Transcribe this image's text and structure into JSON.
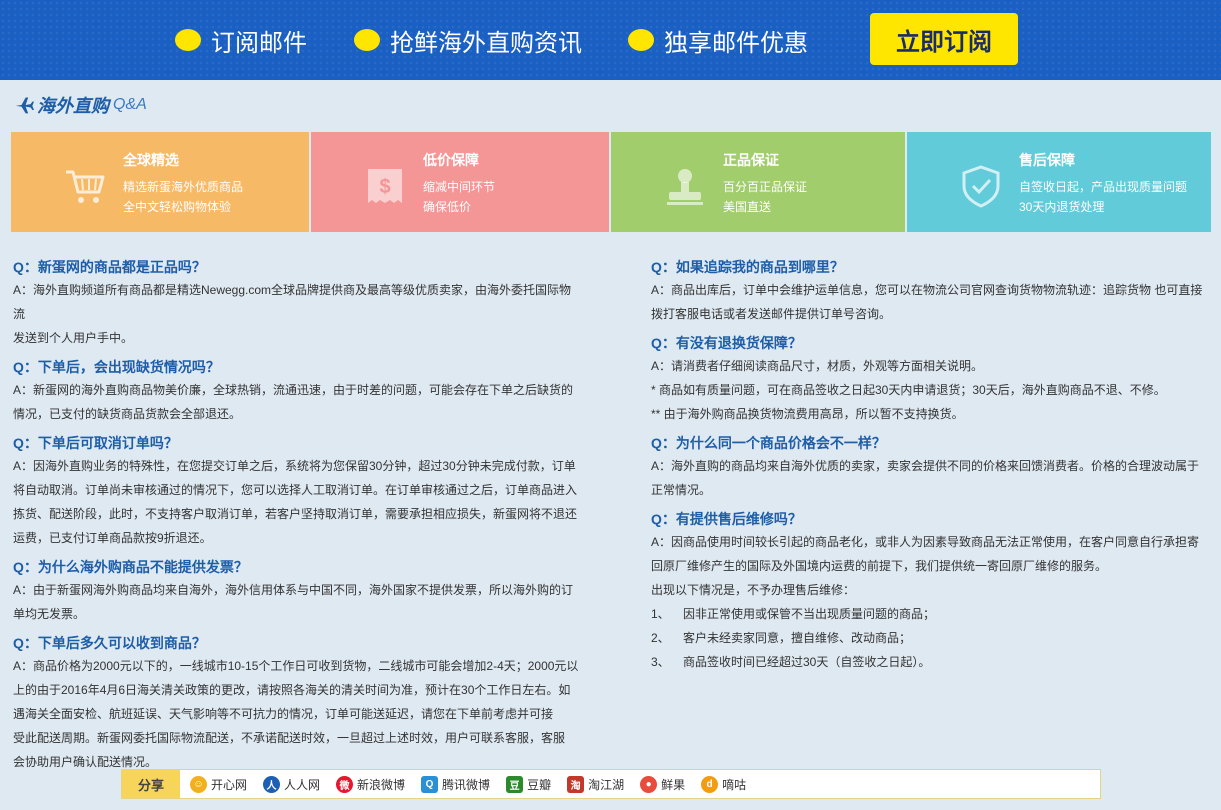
{
  "banner": {
    "features": [
      "订阅邮件",
      "抢鲜海外直购资讯",
      "独享邮件优惠"
    ],
    "cta": "立即订阅"
  },
  "section": {
    "title_cn": "海外直购",
    "title_en": "Q&A"
  },
  "cards": [
    {
      "title": "全球精选",
      "lines": [
        "精选新蛋海外优质商品",
        "全中文轻松购物体验"
      ],
      "color": "#f6b966",
      "icon": "cart-icon"
    },
    {
      "title": "低价保障",
      "lines": [
        "缩减中间环节",
        "确保低价"
      ],
      "color": "#f49596",
      "icon": "price-receipt-icon"
    },
    {
      "title": "正品保证",
      "lines": [
        "百分百正品保证",
        "美国直送"
      ],
      "color": "#a1cd6c",
      "icon": "stamp-icon"
    },
    {
      "title": "售后保障",
      "lines": [
        "自签收日起，产品出现质量问题",
        "30天内退货处理"
      ],
      "color": "#62cbd9",
      "icon": "shield-check-icon"
    }
  ],
  "faq_left": [
    {
      "q": "Q：新蛋网的商品都是正品吗？",
      "a": [
        "A：海外直购频道所有商品都是精选Newegg.com全球品牌提供商及最高等级优质卖家，由海外委托国际物流",
        "发送到个人用户手中。"
      ]
    },
    {
      "q": "Q：下单后，会出现缺货情况吗？",
      "a": [
        "A：新蛋网的海外直购商品物美价廉，全球热销，流通迅速，由于时差的问题，可能会存在下单之后缺货的",
        "情况，已支付的缺货商品货款会全部退还。"
      ]
    },
    {
      "q": "Q：下单后可取消订单吗？",
      "a": [
        "A：因海外直购业务的特殊性，在您提交订单之后，系统将为您保留30分钟，超过30分钟未完成付款，订单",
        "将自动取消。订单尚未审核通过的情况下，您可以选择人工取消订单。在订单审核通过之后，订单商品进入",
        "拣货、配送阶段，此时，不支持客户取消订单，若客户坚持取消订单，需要承担相应损失，新蛋网将不退还",
        "运费，已支付订单商品款按9折退还。"
      ]
    },
    {
      "q": "Q：为什么海外购商品不能提供发票？",
      "a": [
        "A：由于新蛋网海外购商品均来自海外，海外信用体系与中国不同，海外国家不提供发票，所以海外购的订",
        "单均无发票。"
      ]
    },
    {
      "q": "Q：下单后多久可以收到商品？",
      "a": [
        "A：商品价格为2000元以下的，一线城市10-15个工作日可收到货物，二线城市可能会增加2-4天；2000元以",
        "上的由于2016年4月6日海关清关政策的更改，请按照各海关的清关时间为准，预计在30个工作日左右。如",
        "遇海关全面安检、航班延误、天气影响等不可抗力的情况，订单可能送延迟，请您在下单前考虑并可接",
        "受此配送周期。新蛋网委托国际物流配送，不承诺配送时效，一旦超过上述时效，用户可联系客服，客服",
        "会协助用户确认配送情况。"
      ]
    }
  ],
  "faq_right": [
    {
      "q": "Q：如果追踪我的商品到哪里？",
      "a": [
        "A：商品出库后，订单中会维护运单信息，您可以在物流公司官网查询货物物流轨迹：追踪货物  也可直接",
        "拨打客服电话或者发送邮件提供订单号咨询。"
      ]
    },
    {
      "q": "Q：有没有退换货保障？",
      "a": [
        "A：请消费者仔细阅读商品尺寸，材质，外观等方面相关说明。",
        "* 商品如有质量问题，可在商品签收之日起30天内申请退货；30天后，海外直购商品不退、不修。",
        "** 由于海外购商品换货物流费用高昂，所以暂不支持换货。"
      ]
    },
    {
      "q": "Q：为什么同一个商品价格会不一样？",
      "a": [
        "A：海外直购的商品均来自海外优质的卖家，卖家会提供不同的价格来回馈消费者。价格的合理波动属于",
        "正常情况。"
      ]
    },
    {
      "q": "Q：有提供售后维修吗？",
      "a": [
        "A：因商品使用时间较长引起的商品老化，或非人为因素导致商品无法正常使用，在客户同意自行承担寄",
        "回原厂维修产生的国际及外国境内运费的前提下，我们提供统一寄回原厂维修的服务。",
        "出现以下情况是，不予办理售后维修：",
        "1、    因非正常使用或保管不当出现质量问题的商品；",
        "2、    客户未经卖家同意，擅自维修、改动商品；",
        "3、    商品签收时间已经超过30天（自签收之日起）。"
      ]
    }
  ],
  "share": {
    "label": "分享",
    "items": [
      {
        "label": "开心网",
        "icon": "kaixin-icon",
        "color": "#f2b01e"
      },
      {
        "label": "人人网",
        "icon": "renren-icon",
        "color": "#1d5fb4"
      },
      {
        "label": "新浪微博",
        "icon": "sina-weibo-icon",
        "color": "#e6162d"
      },
      {
        "label": "腾讯微博",
        "icon": "tencent-weibo-icon",
        "color": "#2a8fd6"
      },
      {
        "label": "豆瓣",
        "icon": "douban-icon",
        "color": "#2b8a2b"
      },
      {
        "label": "淘江湖",
        "icon": "taojianghu-icon",
        "color": "#c0392b"
      },
      {
        "label": "鲜果",
        "icon": "xianguo-icon",
        "color": "#e74c3c"
      },
      {
        "label": "嘀咕",
        "icon": "digu-icon",
        "color": "#f39c12"
      }
    ]
  }
}
